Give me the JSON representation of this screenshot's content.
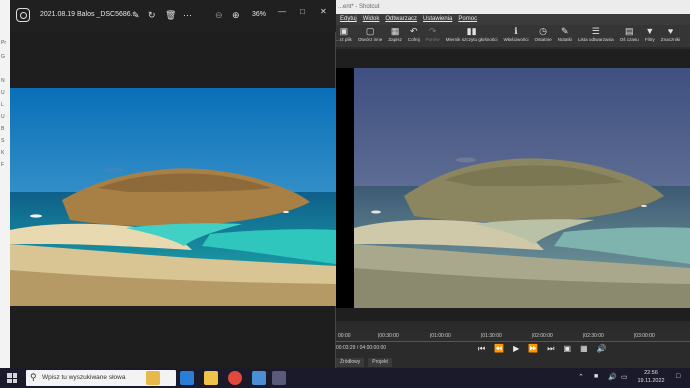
{
  "photos": {
    "title": "2021.08.19 Balos _DSC5686...",
    "zoom": "36%",
    "icons": [
      "photos-app-icon",
      "edit-icon",
      "rotate-icon",
      "delete-icon",
      "more-icon",
      "zoom-out-icon",
      "zoom-in-icon"
    ],
    "window_controls": [
      "minimize",
      "maximize",
      "close"
    ]
  },
  "left_panel": {
    "labels": [
      "Pr",
      "G",
      "N",
      "U",
      "L",
      "U",
      "B",
      "S",
      "K",
      "F"
    ]
  },
  "shotcut": {
    "title": "...ent* - Shotcut",
    "menu": [
      "Edytuj",
      "Widok",
      "Odtwarzacz",
      "Ustawienia",
      "Pomoc"
    ],
    "toolbar": [
      {
        "label": "...rz plik",
        "icon": "open-icon"
      },
      {
        "label": "Otwórz inne",
        "icon": "open-other-icon"
      },
      {
        "label": "Zapisz",
        "icon": "save-icon"
      },
      {
        "label": "Cofnij",
        "icon": "undo-icon"
      },
      {
        "label": "Ponów",
        "icon": "redo-icon",
        "disabled": true
      },
      {
        "label": "Miernik szczytu głośności",
        "icon": "peak-meter-icon"
      },
      {
        "label": "Właściwości",
        "icon": "properties-icon"
      },
      {
        "label": "Ostatnie",
        "icon": "recent-icon"
      },
      {
        "label": "Notatki",
        "icon": "notes-icon"
      },
      {
        "label": "Lista odtwarzania",
        "icon": "playlist-icon"
      },
      {
        "label": "Oś czasu",
        "icon": "timeline-icon"
      },
      {
        "label": "Filtry",
        "icon": "filters-icon"
      },
      {
        "label": "Znaczniki",
        "icon": "markers-icon"
      }
    ],
    "ruler": [
      "00:00",
      "|00:30:00",
      "|01:00:00",
      "|01:30:00",
      "|02:00:00",
      "|02:30:00",
      "|03:00:00"
    ],
    "timecode_current": "00:03:29",
    "timecode_total": "/ 04:00:00:00",
    "tabs": [
      "Źródłowy",
      "Projekt"
    ]
  },
  "taskbar": {
    "search_placeholder": "Wpisz tu wyszukiwane słowa",
    "time": "22:56",
    "date": "19.11.2022"
  }
}
